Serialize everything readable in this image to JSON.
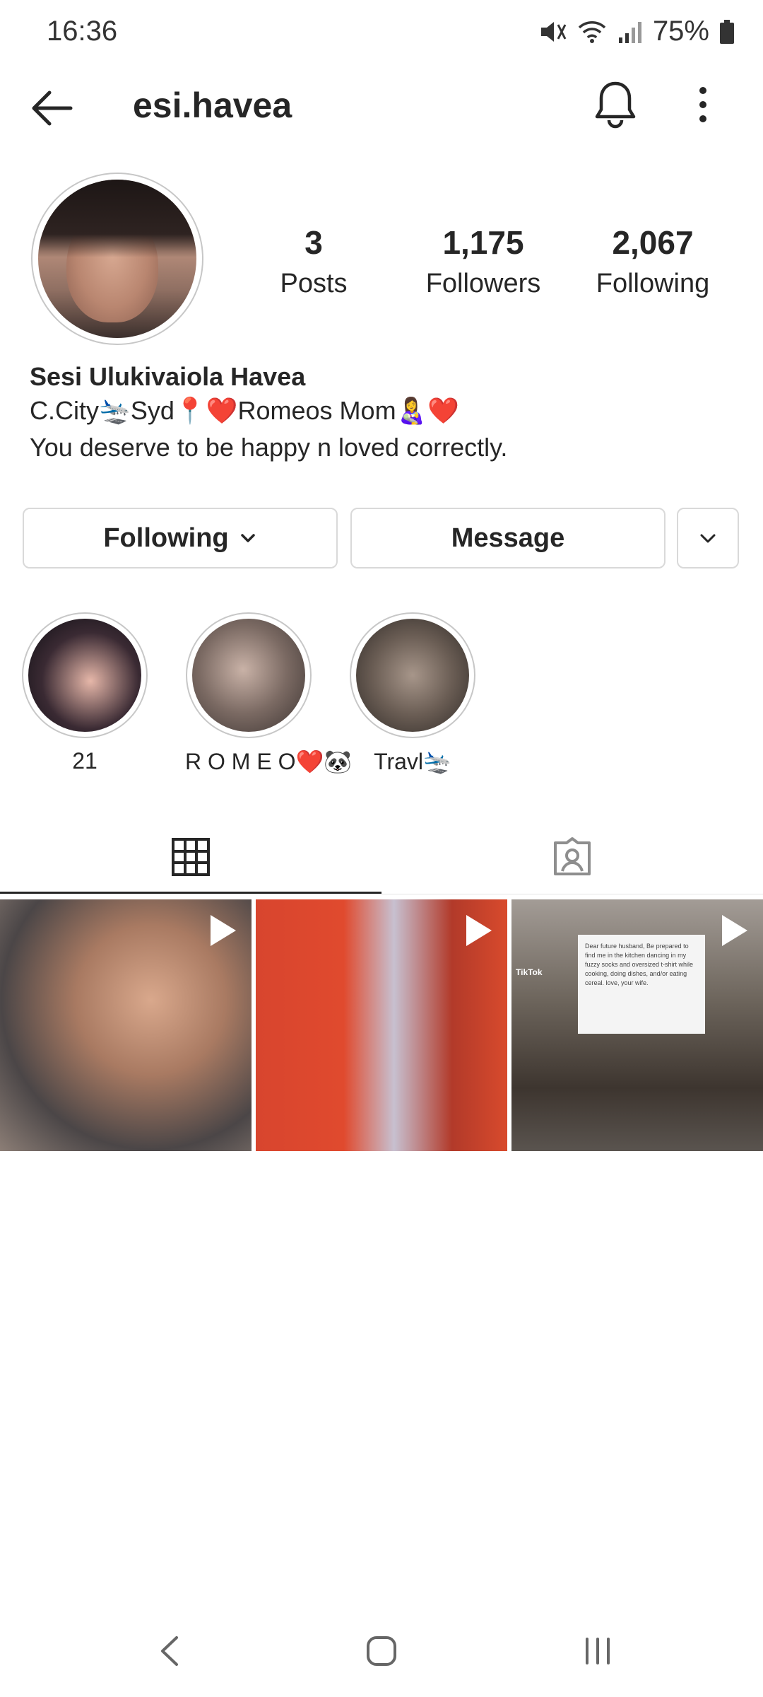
{
  "status": {
    "time": "16:36",
    "battery": "75%"
  },
  "header": {
    "username": "esi.havea"
  },
  "profile": {
    "stats": [
      {
        "value": "3",
        "label": "Posts"
      },
      {
        "value": "1,175",
        "label": "Followers"
      },
      {
        "value": "2,067",
        "label": "Following"
      }
    ],
    "full_name": "Sesi Ulukivaiola Havea",
    "bio_line1": "C.City🛬Syd📍❤️Romeos Mom👩‍🍼❤️",
    "bio_line2": "You deserve to be happy n loved correctly."
  },
  "actions": {
    "following_label": "Following",
    "message_label": "Message"
  },
  "highlights": [
    {
      "label": "21"
    },
    {
      "label": "R O M E O❤️🐼"
    },
    {
      "label": "Travl🛬"
    }
  ],
  "tabs": {
    "active": "grid",
    "items": [
      "grid-icon",
      "tagged-icon"
    ]
  },
  "posts": {
    "count": 3,
    "note_text": "Dear future husband, Be prepared to find me in the kitchen dancing in my fuzzy socks and oversized t-shirt while cooking, doing dishes, and/or eating cereal. love, your wife.",
    "tiktok_label": "TikTok"
  },
  "colors": {
    "text": "#262626",
    "border": "#d9d9d9",
    "background": "#ffffff"
  }
}
